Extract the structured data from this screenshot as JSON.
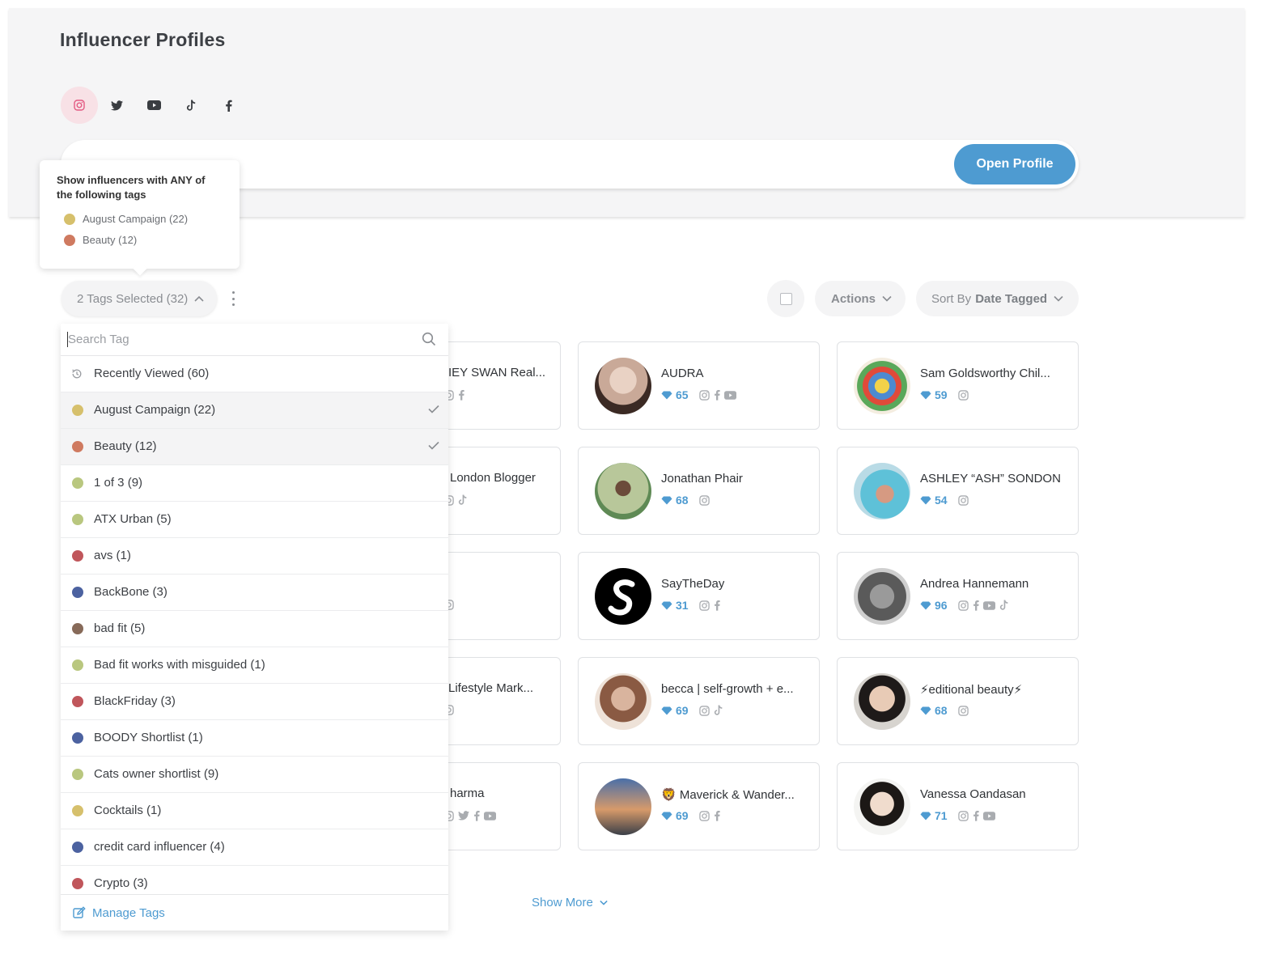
{
  "colors": {
    "accent": "#4e9bd1",
    "instagram_active_bg": "#f8e1e6",
    "instagram_pink": "#e35a82"
  },
  "header": {
    "title": "Influencer Profiles",
    "networks": [
      "instagram-icon",
      "twitter-icon",
      "youtube-icon",
      "tiktok-icon",
      "facebook-icon"
    ],
    "active_network": "instagram",
    "open_profile_label": "Open Profile"
  },
  "tooltip": {
    "title": "Show influencers with ANY of the following tags",
    "tags": [
      {
        "label": "August Campaign (22)",
        "color": "#d6c06c"
      },
      {
        "label": "Beauty (12)",
        "color": "#cf7a60"
      }
    ]
  },
  "toolbar": {
    "tags_selected_label": "2 Tags Selected (32)",
    "actions_label": "Actions",
    "sort_prefix": "Sort By",
    "sort_value": "Date Tagged"
  },
  "dropdown": {
    "search_placeholder": "Search Tag",
    "items": [
      {
        "label": "Recently Viewed (60)",
        "icon": "history-icon"
      },
      {
        "label": "August Campaign (22)",
        "color": "#d6c06c",
        "selected": true
      },
      {
        "label": "Beauty (12)",
        "color": "#cf7a60",
        "selected": true
      },
      {
        "label": "1 of 3 (9)",
        "color": "#b9c77f"
      },
      {
        "label": "ATX Urban (5)",
        "color": "#b9c77f"
      },
      {
        "label": "avs (1)",
        "color": "#c0565b"
      },
      {
        "label": "BackBone (3)",
        "color": "#4c62a0"
      },
      {
        "label": "bad fit (5)",
        "color": "#876a59"
      },
      {
        "label": "Bad fit works with misguided (1)",
        "color": "#b9c77f"
      },
      {
        "label": "BlackFriday (3)",
        "color": "#c0565b"
      },
      {
        "label": "BOODY Shortlist (1)",
        "color": "#4c62a0"
      },
      {
        "label": "Cats owner shortlist (9)",
        "color": "#b9c77f"
      },
      {
        "label": "Cocktails (1)",
        "color": "#d6c06c"
      },
      {
        "label": "credit card influencer (4)",
        "color": "#4c62a0"
      },
      {
        "label": "Crypto (3)",
        "color": "#c0565b"
      }
    ],
    "manage_label": "Manage Tags"
  },
  "cards_partial": [
    {
      "name": "IEY SWAN Real...",
      "socials": [
        "instagram-icon",
        "facebook-icon"
      ]
    },
    {
      "name": "London Blogger",
      "socials": [
        "instagram-icon",
        "tiktok-icon"
      ]
    },
    {
      "name": "",
      "socials": [
        "instagram-icon"
      ]
    },
    {
      "name": "Lifestyle Mark...",
      "socials": [
        "instagram-icon"
      ]
    },
    {
      "name": "harma",
      "socials": [
        "instagram-icon",
        "twitter-icon",
        "facebook-icon",
        "youtube-icon"
      ]
    }
  ],
  "cards": [
    {
      "name": "AUDRA",
      "score": "65",
      "socials": [
        "instagram-icon",
        "facebook-icon",
        "youtube-icon"
      ]
    },
    {
      "name": "Sam Goldsworthy Chil...",
      "score": "59",
      "socials": [
        "instagram-icon"
      ]
    },
    {
      "name": "Jonathan Phair",
      "score": "68",
      "socials": [
        "instagram-icon"
      ]
    },
    {
      "name": "ASHLEY “ASH” SONDON",
      "score": "54",
      "socials": [
        "instagram-icon"
      ]
    },
    {
      "name": "SayTheDay",
      "score": "31",
      "socials": [
        "instagram-icon",
        "facebook-icon"
      ]
    },
    {
      "name": "Andrea Hannemann",
      "score": "96",
      "socials": [
        "instagram-icon",
        "facebook-icon",
        "youtube-icon",
        "tiktok-icon"
      ]
    },
    {
      "name": "becca | self-growth + e...",
      "score": "69",
      "socials": [
        "instagram-icon",
        "tiktok-icon"
      ]
    },
    {
      "name": "⚡editional beauty⚡",
      "score": "68",
      "socials": [
        "instagram-icon"
      ]
    },
    {
      "name": "🦁 Maverick & Wander...",
      "score": "69",
      "socials": [
        "instagram-icon",
        "facebook-icon"
      ]
    },
    {
      "name": "Vanessa Oandasan",
      "score": "71",
      "socials": [
        "instagram-icon",
        "facebook-icon",
        "youtube-icon"
      ]
    }
  ],
  "show_more_label": "Show More"
}
